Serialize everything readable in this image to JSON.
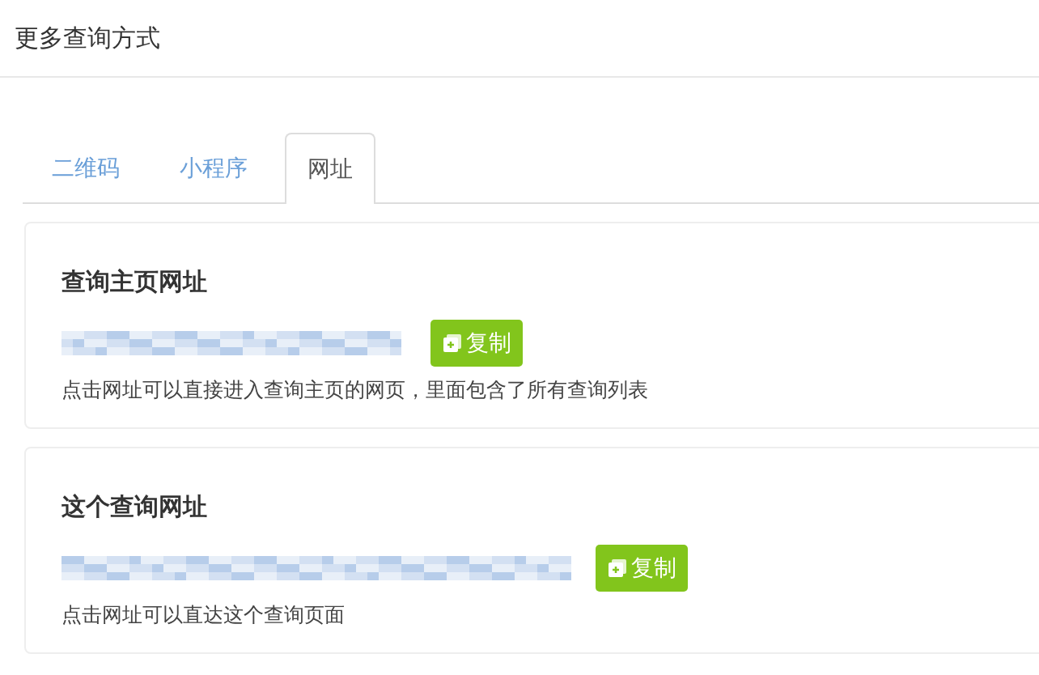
{
  "page_title": "更多查询方式",
  "tabs": [
    {
      "label": "二维码",
      "selected": false
    },
    {
      "label": "小程序",
      "selected": false
    },
    {
      "label": "网址",
      "selected": true
    }
  ],
  "sections": [
    {
      "title": "查询主页网址",
      "button": "复制",
      "description": "点击网址可以直接进入查询主页的网页，里面包含了所有查询列表"
    },
    {
      "title": "这个查询网址",
      "button": "复制",
      "description": "点击网址可以直达这个查询页面"
    }
  ]
}
